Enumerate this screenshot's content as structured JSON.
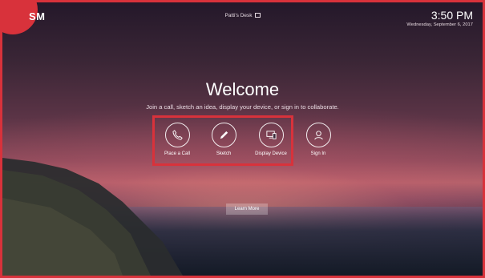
{
  "header": {
    "logo": "SM",
    "desk_name": "Patti's Desk",
    "time": "3:50 PM",
    "date": "Wednesday, September 6, 2017"
  },
  "main": {
    "title": "Welcome",
    "subtitle": "Join a call, sketch an idea, display your device, or sign in to collaborate.",
    "actions": [
      {
        "label": "Place a Call",
        "icon": "phone-icon"
      },
      {
        "label": "Sketch",
        "icon": "pencil-icon"
      },
      {
        "label": "Display Device",
        "icon": "display-device-icon"
      },
      {
        "label": "Sign In",
        "icon": "user-icon"
      }
    ],
    "learn_more": "Learn More"
  },
  "colors": {
    "highlight": "#d8323b",
    "text": "#ffffff"
  }
}
